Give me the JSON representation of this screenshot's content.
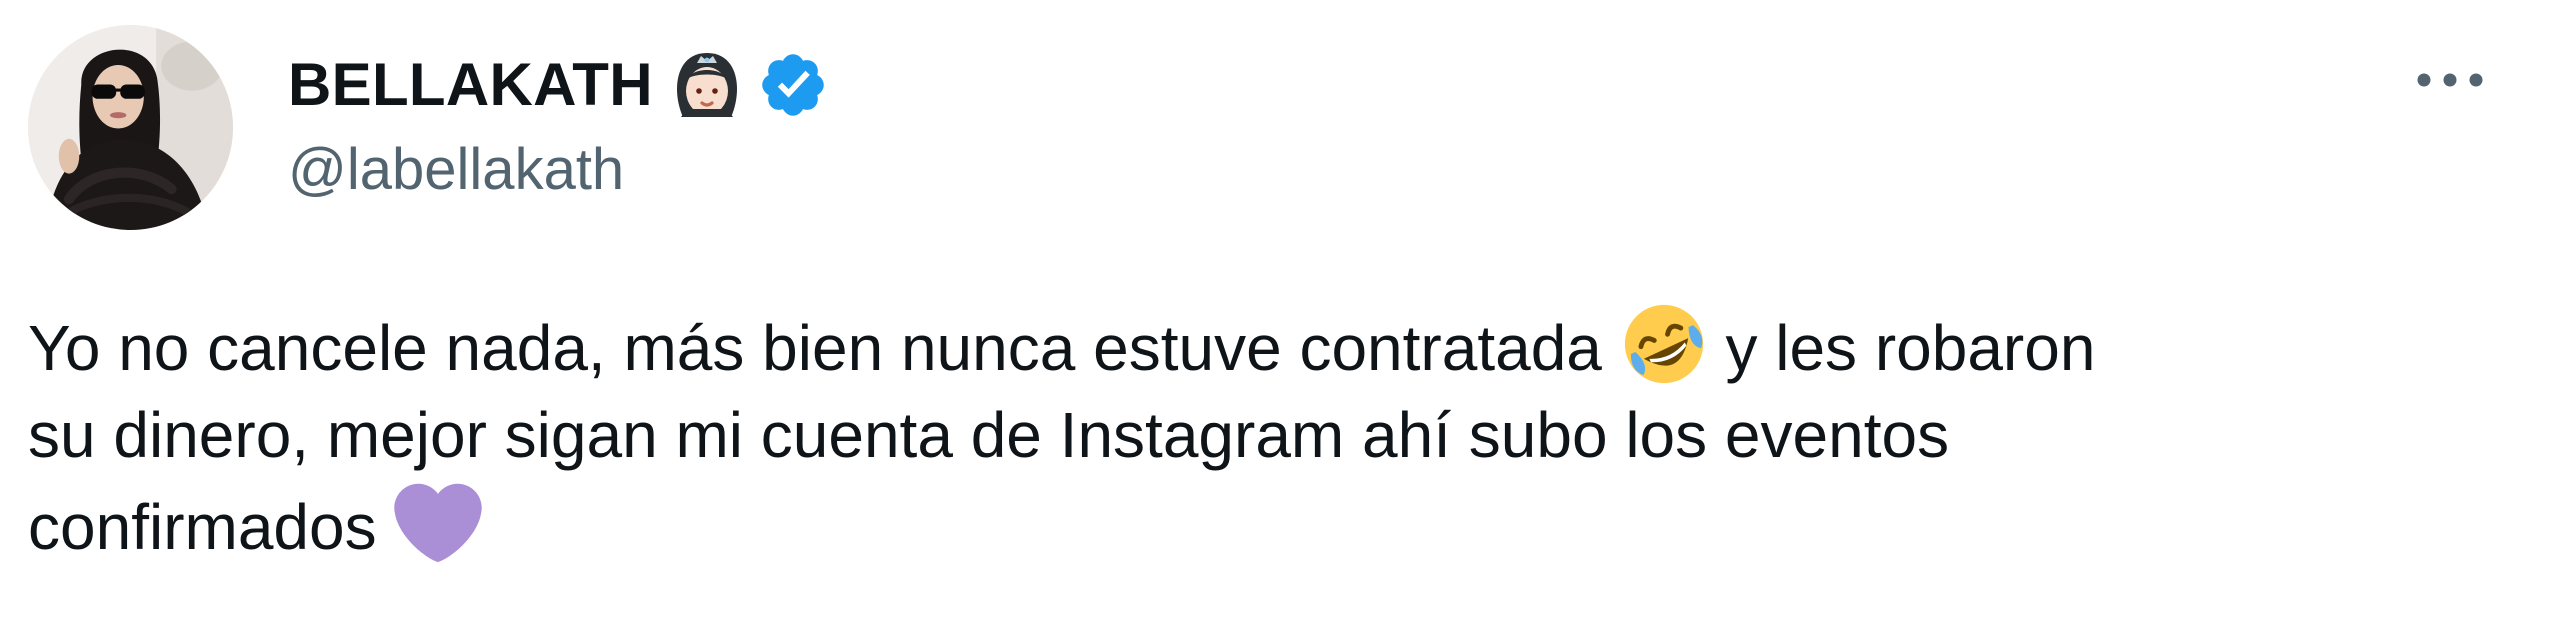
{
  "user": {
    "display_name": "BELLAKATH",
    "username": "@labellakath",
    "verified": true
  },
  "icons": {
    "name_emoji": "princess-emoji-icon",
    "verified": "verified-badge-icon",
    "more": "more-options-icon",
    "laugh": "rolling-on-floor-laughing-emoji-icon",
    "heart": "purple-heart-emoji-icon"
  },
  "colors": {
    "text": "#0f1419",
    "secondary_text": "#536471",
    "verified": "#1d9bf0",
    "purple_heart": "#aa8ed6"
  },
  "tweet": {
    "line1_a": "Yo no cancele nada, más bien nunca estuve contratada",
    "line1_b": "y les robaron",
    "line2": "su dinero, mejor sigan mi cuenta de Instagram ahí subo los eventos",
    "line3": "confirmados"
  }
}
